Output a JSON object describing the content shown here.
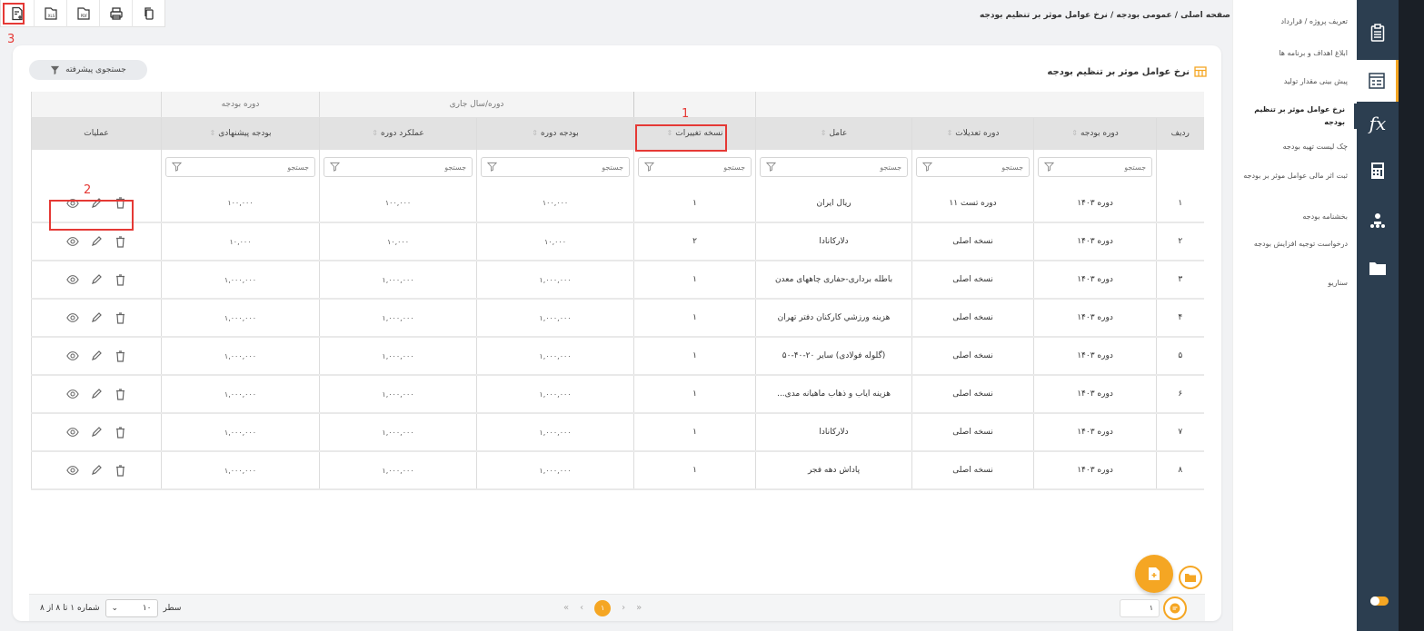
{
  "breadcrumb": "صفحه اصلی / عمومی بودجه / نرخ عوامل موثر بر تنظیم بودجه",
  "panel": {
    "title": "نرخ عوامل موثر بر تنظیم بودجه",
    "advanced_search": "جستجوی پیشرفته"
  },
  "annotations": [
    "1",
    "2",
    "3"
  ],
  "table": {
    "group_headers": {
      "current": "دوره/سال جاری",
      "budget_period": "دوره بودجه"
    },
    "columns": [
      "ردیف",
      "دوره بودجه",
      "دوره تعدیلات",
      "عامل",
      "نسخه تغییرات",
      "بودجه دوره",
      "عملکرد دوره",
      "بودجه پیشنهادی",
      "عملیات"
    ],
    "filter_placeholder": "جستجو",
    "rows": [
      {
        "idx": "۱",
        "period": "دوره ۱۴۰۳",
        "adj": "دوره تست ۱۱",
        "factor": "ریال ایران",
        "ver": "۱",
        "budget": "۱۰۰,۰۰۰",
        "perf": "۱۰۰,۰۰۰",
        "prop": "۱۰۰,۰۰۰"
      },
      {
        "idx": "۲",
        "period": "دوره ۱۴۰۳",
        "adj": "نسخه اصلی",
        "factor": "دلارکانادا",
        "ver": "۲",
        "budget": "۱۰,۰۰۰",
        "perf": "۱۰,۰۰۰",
        "prop": "۱۰,۰۰۰"
      },
      {
        "idx": "۳",
        "period": "دوره ۱۴۰۳",
        "adj": "نسخه اصلی",
        "factor": "باطله برداری-حفاری چاههای معدن",
        "ver": "۱",
        "budget": "۱,۰۰۰,۰۰۰",
        "perf": "۱,۰۰۰,۰۰۰",
        "prop": "۱,۰۰۰,۰۰۰"
      },
      {
        "idx": "۴",
        "period": "دوره ۱۴۰۳",
        "adj": "نسخه اصلی",
        "factor": "هزينه ورزشي كاركنان دفتر تهران",
        "ver": "۱",
        "budget": "۱,۰۰۰,۰۰۰",
        "perf": "۱,۰۰۰,۰۰۰",
        "prop": "۱,۰۰۰,۰۰۰"
      },
      {
        "idx": "۵",
        "period": "دوره ۱۴۰۳",
        "adj": "نسخه اصلی",
        "factor": "(گلوله فولادی) سایر ۲۰-۴۰-۵۰",
        "ver": "۱",
        "budget": "۱,۰۰۰,۰۰۰",
        "perf": "۱,۰۰۰,۰۰۰",
        "prop": "۱,۰۰۰,۰۰۰"
      },
      {
        "idx": "۶",
        "period": "دوره ۱۴۰۳",
        "adj": "نسخه اصلی",
        "factor": "هزینه ایاب و ذهاب ماهیانه مدی...",
        "ver": "۱",
        "budget": "۱,۰۰۰,۰۰۰",
        "perf": "۱,۰۰۰,۰۰۰",
        "prop": "۱,۰۰۰,۰۰۰"
      },
      {
        "idx": "۷",
        "period": "دوره ۱۴۰۳",
        "adj": "نسخه اصلی",
        "factor": "دلارکانادا",
        "ver": "۱",
        "budget": "۱,۰۰۰,۰۰۰",
        "perf": "۱,۰۰۰,۰۰۰",
        "prop": "۱,۰۰۰,۰۰۰"
      },
      {
        "idx": "۸",
        "period": "دوره ۱۴۰۳",
        "adj": "نسخه اصلی",
        "factor": "پاداش دهه فجر",
        "ver": "۱",
        "budget": "۱,۰۰۰,۰۰۰",
        "perf": "۱,۰۰۰,۰۰۰",
        "prop": "۱,۰۰۰,۰۰۰"
      }
    ]
  },
  "footer": {
    "rows_label": "سطر",
    "rows_value": "۱۰",
    "record_info": "شماره ۱ تا ۸ از ۸",
    "page": "۱",
    "page_input": "۱"
  },
  "menu": [
    "تعریف پروژه / قرارداد",
    "ابلاغ اهداف و برنامه ها",
    "پیش بینی مقدار تولید",
    "نرخ عوامل موثر بر تنظیم بودجه",
    "چک لیست تهیه بودجه",
    "ثبت اثر مالی عوامل موثر بر بودجه",
    "بخشنامه بودجه",
    "درخواست توجیه افزایش بودجه",
    "سناریو"
  ],
  "icons": {
    "toolbar": [
      "add-document-icon",
      "excel-export-icon",
      "pdf-export-icon",
      "print-icon",
      "copy-icon"
    ],
    "iconbar": [
      "clipboard-icon",
      "form-list-icon",
      "formula-fx-icon",
      "calculator-icon",
      "org-chart-icon",
      "folder-icon"
    ]
  },
  "colors": {
    "accent": "#f5a623",
    "sidebar": "#2c3e50",
    "highlight": "#e53935"
  }
}
